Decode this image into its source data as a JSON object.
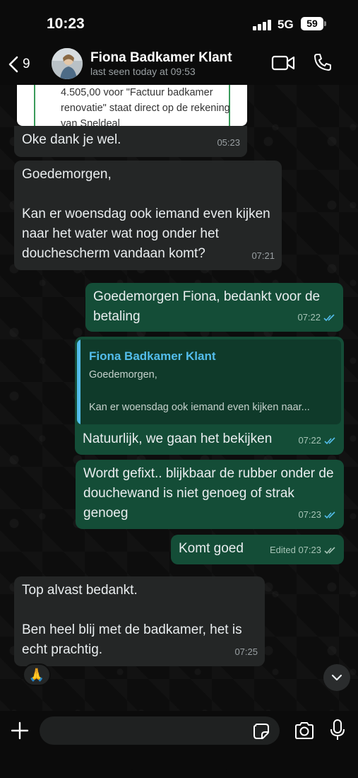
{
  "status_bar": {
    "time": "10:23",
    "network": "5G",
    "battery": "59"
  },
  "header": {
    "back_count": "9",
    "contact_name": "Fiona Badkamer Klant",
    "contact_status": "last seen today at 09:53"
  },
  "quoted_card": {
    "text": "4.505,00 voor \"Factuur badkamer renovatie\" staat direct op de rekening van Sneldeal"
  },
  "messages": [
    {
      "text": "Oke dank je wel.",
      "time": "05:23",
      "direction": "in"
    },
    {
      "line1": "Goedemorgen,",
      "line2": "Kan er woensdag ook iemand even kijken naar het water wat nog onder het douchescherm vandaan komt?",
      "time": "07:21",
      "direction": "in"
    },
    {
      "text": "Goedemorgen Fiona, bedankt voor de betaling",
      "time": "07:22",
      "direction": "out"
    },
    {
      "text": "Natuurlijk, we gaan het bekijken",
      "time": "07:22",
      "direction": "out",
      "reply_to": {
        "author": "Fiona Badkamer Klant",
        "line1": "Goedemorgen,",
        "line2": "Kan er woensdag ook iemand even kijken naar..."
      }
    },
    {
      "text": "Wordt gefixt.. blijkbaar de rubber onder de douchewand is niet genoeg of strak genoeg",
      "time": "07:23",
      "direction": "out"
    },
    {
      "text": "Komt goed",
      "time": "Edited 07:23",
      "direction": "out"
    },
    {
      "line1": "Top alvast bedankt.",
      "line2": "Ben heel blij met de badkamer, het is echt prachtig.",
      "time": "07:25",
      "direction": "in",
      "reaction": "🙏"
    }
  ],
  "composer": {
    "value": "",
    "placeholder": ""
  },
  "colors": {
    "incoming_bubble": "#242626",
    "outgoing_bubble": "#144d37",
    "read_ticks": "#53bdeb",
    "reply_author": "#53bdeb"
  }
}
